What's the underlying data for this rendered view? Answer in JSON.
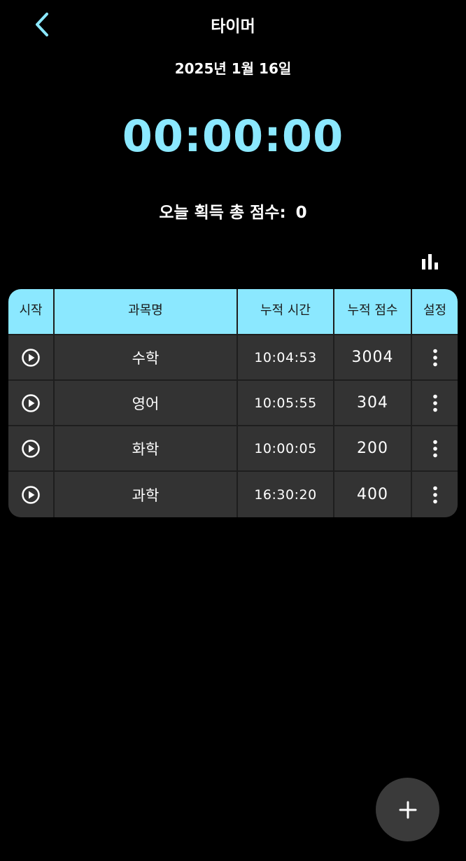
{
  "header": {
    "title": "타이머",
    "back_icon": "chevron-left-icon"
  },
  "date": "2025년 1월 16일",
  "timer": "00:00:00",
  "score": {
    "label": "오늘 획득 총 점수:",
    "value": "0"
  },
  "chart_icon": "bar-chart-icon",
  "table": {
    "columns": [
      "시작",
      "과목명",
      "누적 시간",
      "누적 점수",
      "설정"
    ],
    "rows": [
      {
        "subject": "수학",
        "time": "10:04:53",
        "points": "3004"
      },
      {
        "subject": "영어",
        "time": "10:05:55",
        "points": "304"
      },
      {
        "subject": "화학",
        "time": "10:00:05",
        "points": "200"
      },
      {
        "subject": "과학",
        "time": "16:30:20",
        "points": "400"
      }
    ]
  },
  "fab_icon": "plus-icon",
  "colors": {
    "accent": "#8be8ff",
    "background": "#000000",
    "row": "#333333",
    "fab": "#3a3a3a"
  }
}
